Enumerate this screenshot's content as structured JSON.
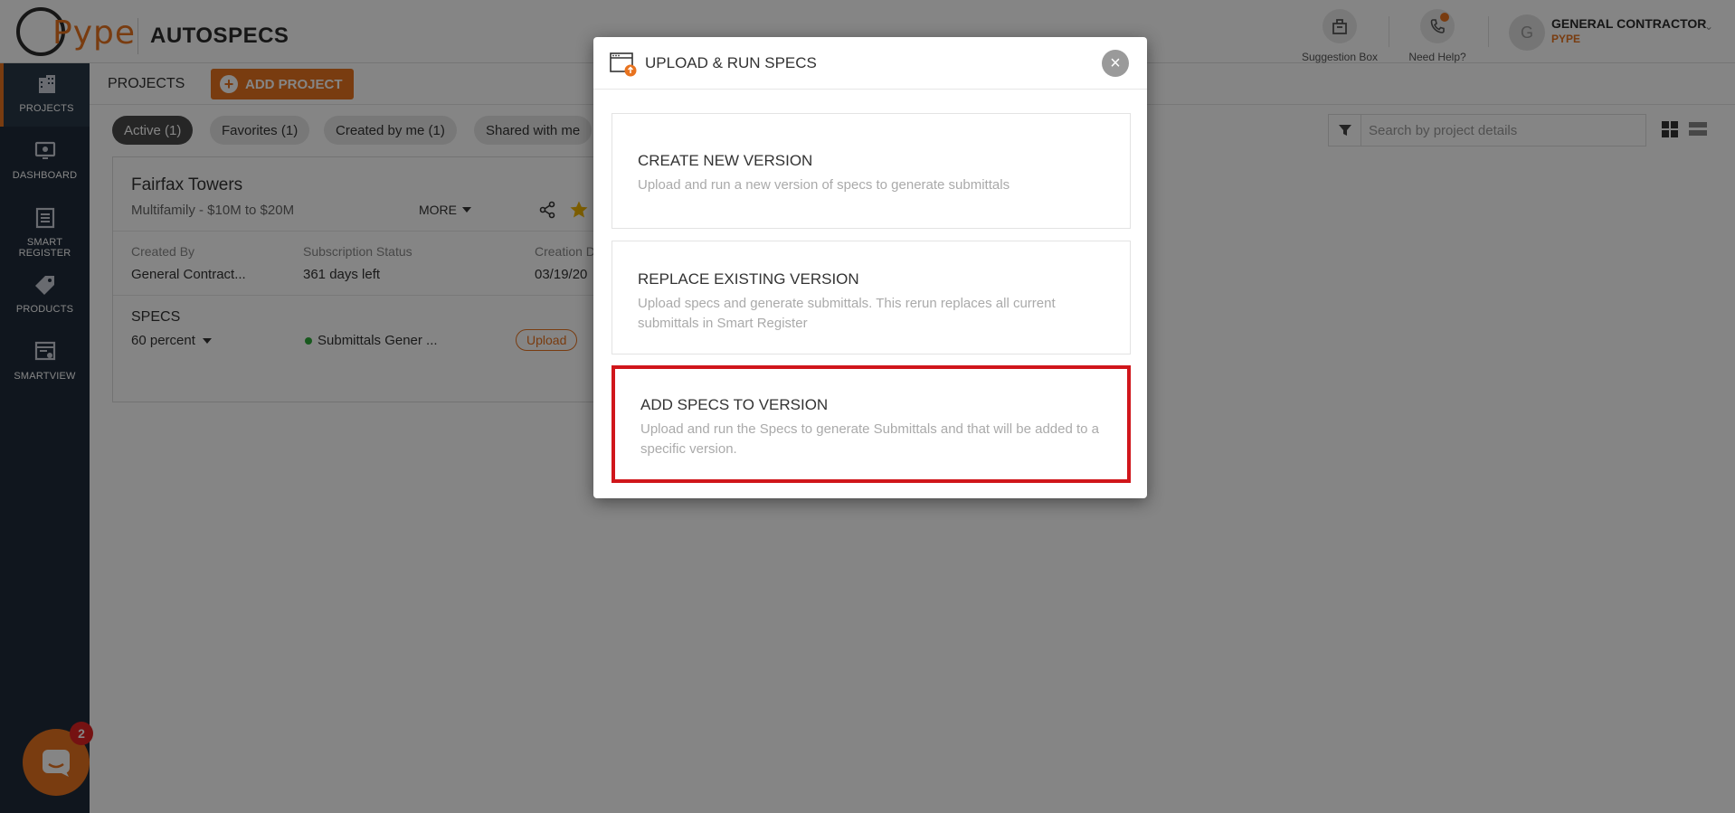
{
  "header": {
    "logo_text": "Pype",
    "app_name": "AUTOSPECS",
    "suggestion_label": "Suggestion Box",
    "help_label": "Need Help?",
    "user_initial": "G",
    "user_name": "GENERAL CONTRACTOR",
    "user_org": "PYPE"
  },
  "sidebar": {
    "items": [
      {
        "label": "PROJECTS",
        "icon": "building-icon"
      },
      {
        "label": "DASHBOARD",
        "icon": "monitor-icon"
      },
      {
        "label": "SMART REGISTER",
        "icon": "list-icon"
      },
      {
        "label": "PRODUCTS",
        "icon": "tag-icon"
      },
      {
        "label": "SMARTVIEW",
        "icon": "smartview-icon"
      }
    ]
  },
  "subheader": {
    "title": "PROJECTS",
    "add_project": "ADD PROJECT"
  },
  "filters": {
    "chips": [
      "Active (1)",
      "Favorites (1)",
      "Created by me (1)",
      "Shared with me"
    ],
    "search_placeholder": "Search by project details"
  },
  "project": {
    "name": "Fairfax Towers",
    "subtitle": "Multifamily  -  $10M to $20M",
    "more": "MORE",
    "created_by_label": "Created By",
    "created_by_value": "General Contract...",
    "subscription_label": "Subscription Status",
    "subscription_value": "361 days left",
    "creation_label": "Creation D",
    "creation_value": "03/19/20",
    "specs_label": "SPECS",
    "specs_value": "60 percent",
    "status_text": "Submittals Gener ...",
    "upload": "Upload"
  },
  "modal": {
    "title": "UPLOAD & RUN SPECS",
    "close": "×",
    "options": [
      {
        "title": "CREATE NEW VERSION",
        "desc": "Upload and run a new version of specs to generate submittals"
      },
      {
        "title": "REPLACE EXISTING VERSION",
        "desc": "Upload specs and generate submittals. This rerun replaces all current submittals in Smart Register"
      },
      {
        "title": "ADD SPECS TO VERSION",
        "desc": "Upload and run the Specs to generate Submittals and that will be added to a specific version."
      }
    ]
  },
  "chat": {
    "badge": "2"
  },
  "colors": {
    "accent": "#e8731f",
    "sidebar_bg": "#1f2b3a",
    "highlight": "#d0161b",
    "status_green": "#2eab3a"
  }
}
